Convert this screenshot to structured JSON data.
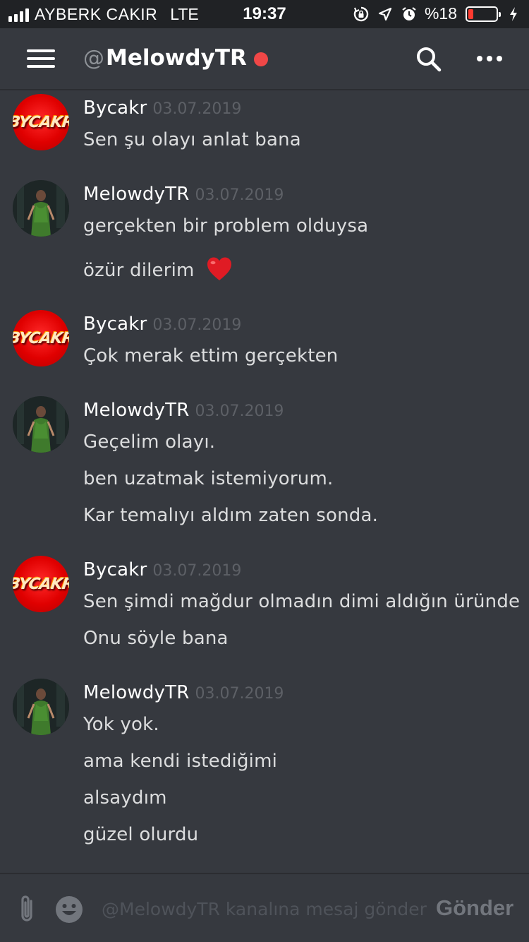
{
  "status_bar": {
    "carrier": "AYBERK CAKIR",
    "network": "LTE",
    "time": "19:37",
    "battery": "%18",
    "battery_level": 0.18
  },
  "header": {
    "at_sign": "@",
    "channel_name": "MelowdyTR",
    "status_color": "#f04747"
  },
  "messages": [
    {
      "author": "Bycakr",
      "timestamp": "03.07.2019",
      "avatar": "bycakr-avatar",
      "lines": [
        "Sen şu olayı anlat bana"
      ]
    },
    {
      "author": "MelowdyTR",
      "timestamp": "03.07.2019",
      "avatar": "melowdy-avatar",
      "lines": [
        "gerçekten bir problem olduysa",
        "özür dilerim"
      ],
      "emoji": "heart-emoji"
    },
    {
      "author": "Bycakr",
      "timestamp": "03.07.2019",
      "avatar": "bycakr-avatar",
      "lines": [
        "Çok merak ettim gerçekten"
      ]
    },
    {
      "author": "MelowdyTR",
      "timestamp": "03.07.2019",
      "avatar": "melowdy-avatar",
      "lines": [
        "Geçelim olayı.",
        "ben uzatmak istemiyorum.",
        "Kar temalıyı aldım zaten sonda."
      ]
    },
    {
      "author": "Bycakr",
      "timestamp": "03.07.2019",
      "avatar": "bycakr-avatar",
      "lines": [
        "Sen şimdi mağdur olmadın dimi aldığın üründe",
        "Onu söyle bana"
      ]
    },
    {
      "author": "MelowdyTR",
      "timestamp": "03.07.2019",
      "avatar": "melowdy-avatar",
      "lines": [
        "Yok yok.",
        "ama kendi istediğimi",
        "alsaydım",
        "güzel olurdu"
      ]
    }
  ],
  "composer": {
    "placeholder": "@MelowdyTR kanalına mesaj gönder",
    "value": "",
    "send_label": "Gönder"
  },
  "avatars": {
    "bycakr_logo_text": "BYCAKR"
  },
  "colors": {
    "background": "#36393f",
    "statusbar": "#202225",
    "message_text": "#dcddde",
    "timestamp": "#5d6066",
    "muted": "#72767d"
  }
}
